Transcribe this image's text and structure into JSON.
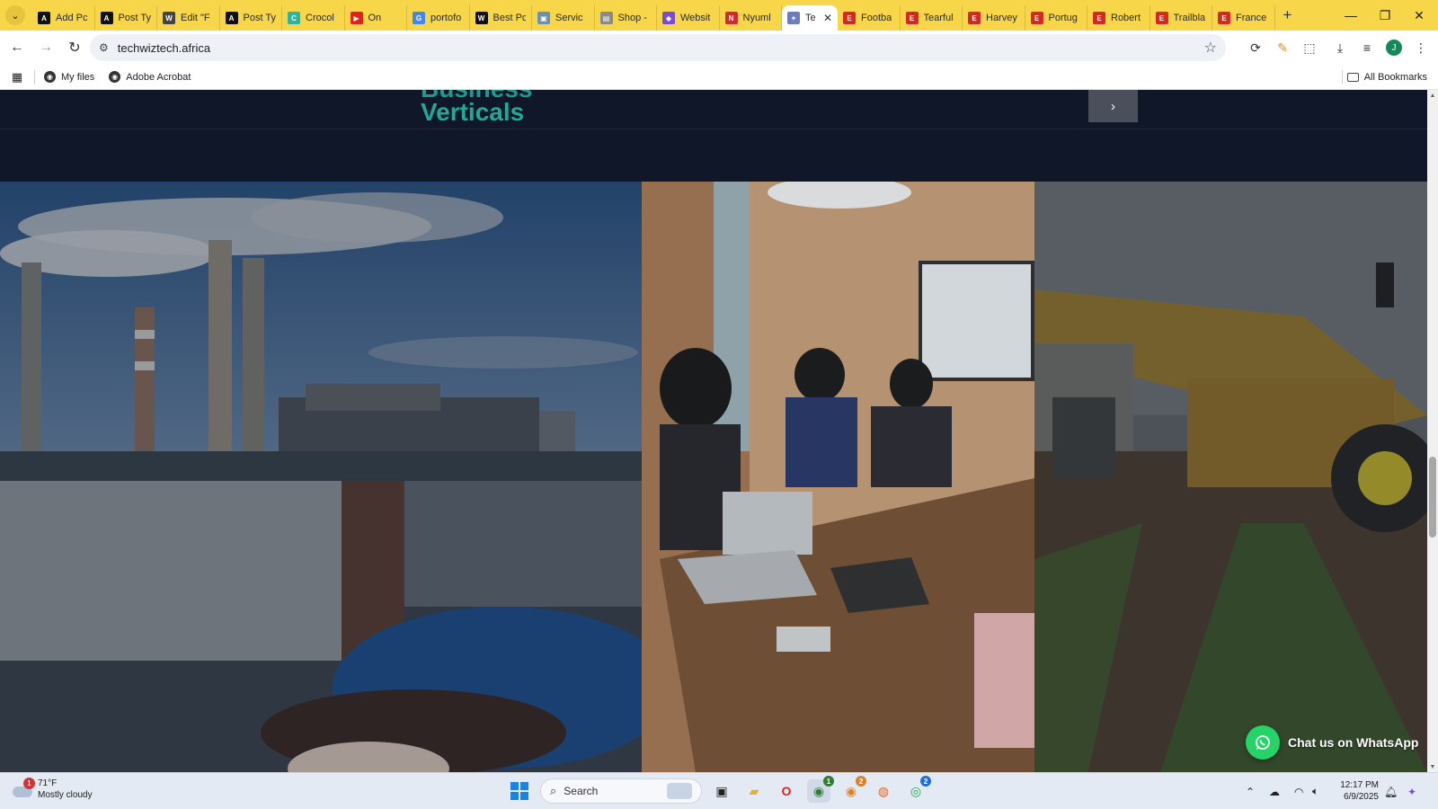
{
  "browser": {
    "tabs": [
      {
        "title": "Add Pc",
        "favicon": "ato-logo-icon",
        "color": "#111111",
        "glyph": "A"
      },
      {
        "title": "Post Ty",
        "favicon": "ato-logo-icon",
        "color": "#111111",
        "glyph": "A"
      },
      {
        "title": "Edit \"F",
        "favicon": "wordpress-icon",
        "color": "#444444",
        "glyph": "W"
      },
      {
        "title": "Post Ty",
        "favicon": "ato-logo-icon",
        "color": "#111111",
        "glyph": "A"
      },
      {
        "title": "Crocol",
        "favicon": "crocoblock-icon",
        "color": "#2bb5a0",
        "glyph": "C"
      },
      {
        "title": "On",
        "favicon": "youtube-icon",
        "color": "#e62117",
        "glyph": "▶"
      },
      {
        "title": "portofo",
        "favicon": "google-icon",
        "color": "#4285f4",
        "glyph": "G"
      },
      {
        "title": "Best Pc",
        "favicon": "w-logo-icon",
        "color": "#111111",
        "glyph": "W"
      },
      {
        "title": "Servic",
        "favicon": "image-icon",
        "color": "#6f8fb0",
        "glyph": "▣"
      },
      {
        "title": "Shop -",
        "favicon": "shop-icon",
        "color": "#8a8a8a",
        "glyph": "▤"
      },
      {
        "title": "Websit",
        "favicon": "puzzle-icon",
        "color": "#7b4bd6",
        "glyph": "◆"
      },
      {
        "title": "Nyuml",
        "favicon": "red-logo-icon",
        "color": "#d12a2a",
        "glyph": "N"
      },
      {
        "title": "Te",
        "favicon": "techwiz-icon",
        "color": "#6b7cc4",
        "glyph": "✦",
        "active": true
      },
      {
        "title": "Footba",
        "favicon": "e-news-icon",
        "color": "#d6281f",
        "glyph": "E"
      },
      {
        "title": "Tearful",
        "favicon": "e-news-icon",
        "color": "#d6281f",
        "glyph": "E"
      },
      {
        "title": "Harvey",
        "favicon": "e-news-icon",
        "color": "#d6281f",
        "glyph": "E"
      },
      {
        "title": "Portug",
        "favicon": "e-news-icon",
        "color": "#d6281f",
        "glyph": "E"
      },
      {
        "title": "Robert",
        "favicon": "e-news-icon",
        "color": "#d6281f",
        "glyph": "E"
      },
      {
        "title": "Trailbla",
        "favicon": "e-news-icon",
        "color": "#d6281f",
        "glyph": "E"
      },
      {
        "title": "France",
        "favicon": "e-news-icon",
        "color": "#d6281f",
        "glyph": "E"
      }
    ],
    "url": "techwiztech.africa",
    "bookmarks": [
      {
        "label": "My files"
      },
      {
        "label": "Adobe Acrobat"
      }
    ],
    "all_bookmarks_label": "All Bookmarks",
    "profile_initial": "J",
    "accent_color": "#f7d64a"
  },
  "page": {
    "heading_partial": "Business",
    "heading": "Verticals",
    "heading_color": "#1fa99a",
    "background_color": "#0f1729",
    "carousel_next_glyph": "›",
    "whatsapp_label": "Chat us on WhatsApp",
    "whatsapp_color": "#25d366"
  },
  "taskbar": {
    "weather_temp": "71°F",
    "weather_desc": "Mostly cloudy",
    "weather_badge": "1",
    "search_placeholder": "Search",
    "time": "12:17 PM",
    "date": "6/9/2025",
    "chrome_badge_1": "1",
    "chrome_badge_2": "2",
    "whatsapp_badge": "2"
  }
}
